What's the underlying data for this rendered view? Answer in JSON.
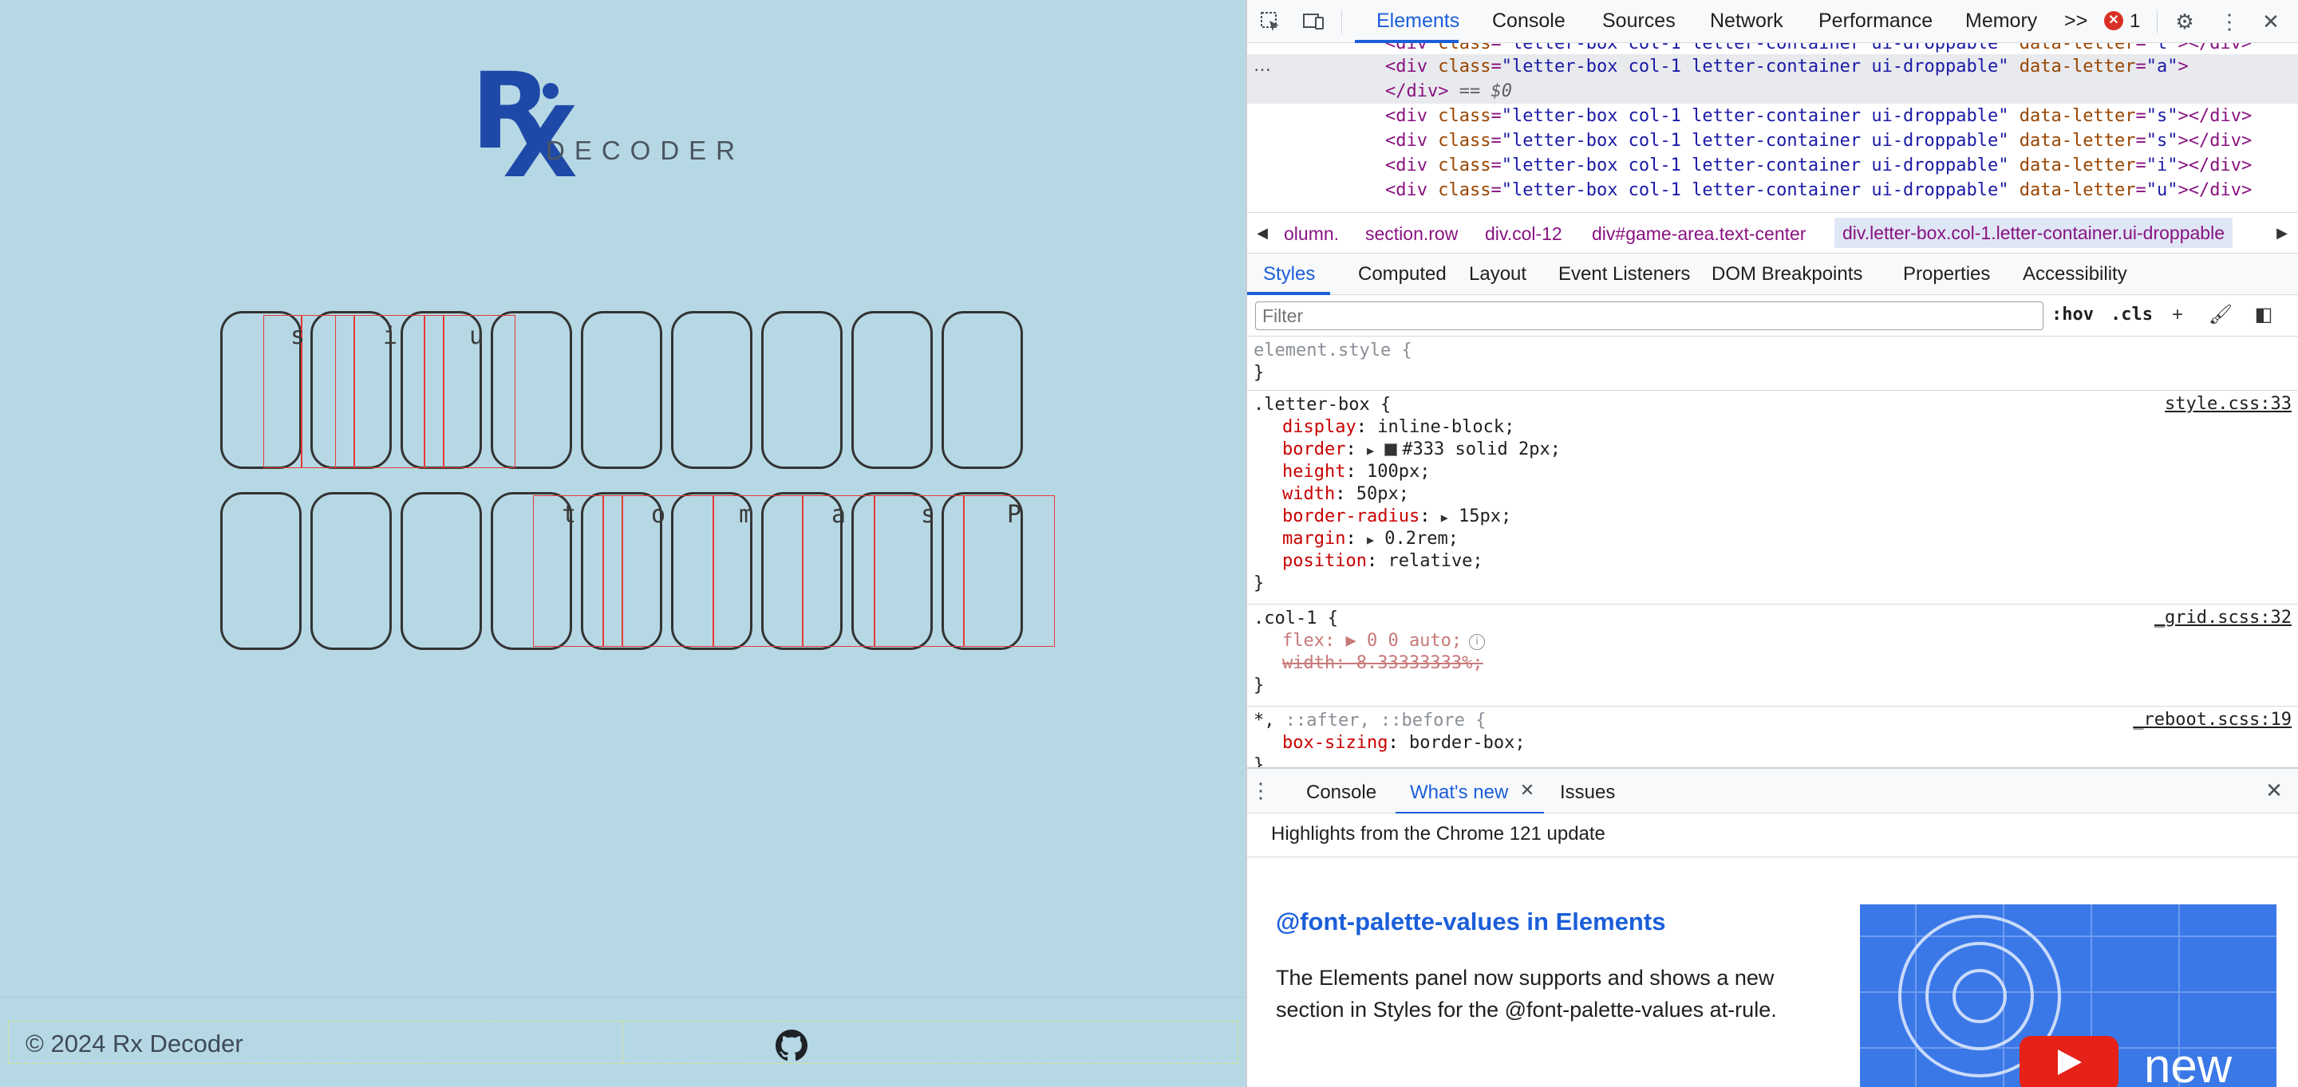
{
  "game": {
    "logo_text": "DECODER",
    "logo_monogram_r": "R",
    "logo_monogram_x": "X",
    "row1_letters": [
      "s",
      "i",
      "u"
    ],
    "row2_letters": [
      "t",
      "o",
      "m",
      "a",
      "s",
      "P"
    ],
    "footer": {
      "copyright": "© 2024 Rx Decoder",
      "github_icon": "github-icon"
    }
  },
  "devtools": {
    "toolbar": {
      "tabs": [
        "Elements",
        "Console",
        "Sources",
        "Network",
        "Performance",
        "Memory"
      ],
      "active_tab": "Elements",
      "more_tabs_label": ">>",
      "error_count": "1",
      "icons": [
        "inspect-icon",
        "device-toggle-icon",
        "settings-icon",
        "more-vert-icon",
        "close-icon"
      ]
    },
    "dom_tree": {
      "selected_suffix": "== $0",
      "lines": [
        {
          "cls": "letter-box col-1 letter-container ui-droppable",
          "letter": "a",
          "selected": true
        },
        {
          "cls": "letter-box col-1 letter-container ui-droppable",
          "letter": "s"
        },
        {
          "cls": "letter-box col-1 letter-container ui-droppable",
          "letter": "s"
        },
        {
          "cls": "letter-box col-1 letter-container ui-droppable",
          "letter": "i"
        },
        {
          "cls": "letter-box col-1 letter-container ui-droppable",
          "letter": "u"
        }
      ]
    },
    "breadcrumb": [
      "olumn.",
      "section.row",
      "div.col-12",
      "div#game-area.text-center",
      "div.letter-box.col-1.letter-container.ui-droppable"
    ],
    "style_tabs": [
      "Styles",
      "Computed",
      "Layout",
      "Event Listeners",
      "DOM Breakpoints",
      "Properties",
      "Accessibility"
    ],
    "filter_placeholder": "Filter",
    "filter_buttons": [
      ":hov",
      ".cls"
    ],
    "rules": {
      "element_style": "element.style {",
      "letter_box": {
        "selector": ".letter-box {",
        "source": "style.css:33",
        "props": [
          {
            "name": "display",
            "value": "inline-block;"
          },
          {
            "name": "border",
            "value": "#333 solid 2px;"
          },
          {
            "name": "height",
            "value": "100px;"
          },
          {
            "name": "width",
            "value": "50px;"
          },
          {
            "name": "border-radius",
            "value": "15px;"
          },
          {
            "name": "margin",
            "value": "0.2rem;"
          },
          {
            "name": "position",
            "value": "relative;"
          }
        ]
      },
      "col_1": {
        "selector": ".col-1 {",
        "source": "_grid.scss:32",
        "flex": "flex: ▶ 0 0 auto;",
        "width": "width: 8.33333333%;"
      },
      "reboot": {
        "selector_star": "*, ",
        "selector_rest": "::after, ::before {",
        "source": "_reboot.scss:19",
        "prop": "box-sizing",
        "value": "border-box;"
      }
    },
    "drawer": {
      "tabs": [
        "Console",
        "What's new",
        "Issues"
      ],
      "active_tab": "What's new",
      "highlight": "Highlights from the Chrome 121 update",
      "feature_title": "@font-palette-values in Elements",
      "feature_desc": "The Elements panel now supports and shows a new section in Styles for the @font-palette-values at-rule.",
      "promo_word": "new"
    }
  }
}
